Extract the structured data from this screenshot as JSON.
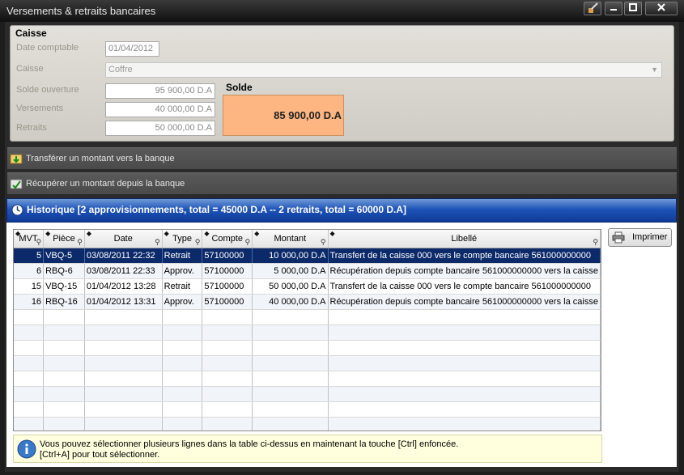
{
  "window": {
    "title": "Versements & retraits bancaires"
  },
  "caisse": {
    "title": "Caisse",
    "date_comptable_label": "Date comptable",
    "date_comptable_value": "01/04/2012",
    "caisse_label": "Caisse",
    "caisse_value": "Coffre",
    "solde_ouverture_label": "Solde ouverture",
    "solde_ouverture_value": "95 900,00 D.A",
    "versements_label": "Versements",
    "versements_value": "40 000,00 D.A",
    "retraits_label": "Retraits",
    "retraits_value": "50 000,00 D.A",
    "solde_label": "Solde",
    "solde_value": "85 900,00 D.A",
    "solde_color": "#fdb681"
  },
  "actions": {
    "transfer_label": "Transférer un montant vers la banque",
    "recover_label": "Récupérer un montant depuis la banque"
  },
  "historique": {
    "title": "Historique [2 approvisionnements, total = 45000 D.A -- 2 retraits, total = 60000 D.A]",
    "columns": [
      "MVT",
      "Pièce",
      "Date",
      "Type",
      "Compte",
      "Montant",
      "Libellé"
    ],
    "rows": [
      [
        "5",
        "VBQ-5",
        "03/08/2011 22:32",
        "Retrait",
        "57100000",
        "10 000,00 D.A",
        "Transfert de la caisse 000 vers le compte bancaire 561000000000"
      ],
      [
        "6",
        "RBQ-6",
        "03/08/2011 22:33",
        "Approv.",
        "57100000",
        "5 000,00 D.A",
        "Récupération depuis compte bancaire 561000000000 vers la caisse"
      ],
      [
        "15",
        "VBQ-15",
        "01/04/2012 13:28",
        "Retrait",
        "57100000",
        "50 000,00 D.A",
        "Transfert de la caisse 000 vers le compte bancaire 561000000000"
      ],
      [
        "16",
        "RBQ-16",
        "01/04/2012 13:31",
        "Approv.",
        "57100000",
        "40 000,00 D.A",
        "Récupération depuis compte bancaire 561000000000 vers la caisse"
      ]
    ],
    "selected_row": 0,
    "accent_color": "#1f54b8"
  },
  "print_button": "Imprimer",
  "info": {
    "line1": "Vous pouvez sélectionner plusieurs lignes dans la table ci-dessus en maintenant la touche [Ctrl] enfoncée.",
    "line2": "[Ctrl+A] pour tout sélectionner."
  }
}
